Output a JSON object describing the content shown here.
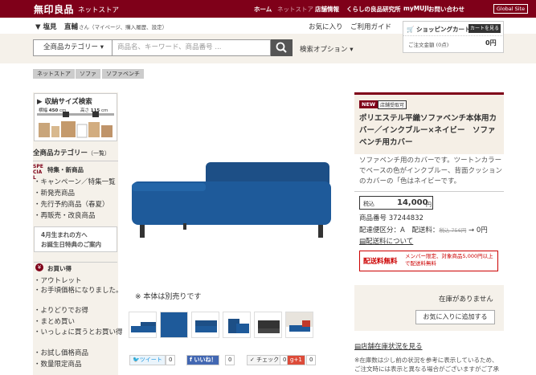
{
  "header": {
    "logo": "無印良品",
    "store": "ネットストア",
    "nav": [
      "ホーム",
      "ネットストア",
      "店舗情報",
      "くらしの良品研究所",
      "myMUJI",
      "お問い合わせ"
    ],
    "global": "Global Site"
  },
  "user": {
    "location": "▼ 塩見",
    "name": "直輔",
    "suffix": "さん（マイページ、購入履歴、設定）",
    "links": [
      "お気に入り",
      "ご利用ガイド"
    ]
  },
  "cart": {
    "title": "ショッピングカート",
    "view_label": "カートを見る",
    "total_label": "ご注文金額",
    "count": "(0点)",
    "amount": "0円"
  },
  "search": {
    "category": "全商品カテゴリー",
    "placeholder": "商品名、キーワード、商品番号 ...",
    "options_label": "検索オプション"
  },
  "breadcrumbs": [
    "ネットストア",
    "ソファ",
    "ソファベンチ"
  ],
  "sidebar": {
    "storage_title": "収納サイズ検索",
    "width_label": "横幅",
    "width_value": "450",
    "depth_label": "高さ",
    "depth_value": "115",
    "unit": "cm",
    "categories_title": "全商品カテゴリー",
    "categories_sub": "（一覧）",
    "special_badge": "SPECIAL",
    "special_title": "特集・新商品",
    "special_items": [
      "キャンペーン／特集一覧",
      "新発売商品",
      "先行予約商品（春夏）",
      "再販売・改良商品"
    ],
    "banner": [
      "4月生まれの方へ",
      "お誕生日特典のご案内"
    ],
    "bargain_title": "お買い得",
    "bargain_mark": "¥",
    "bargain_items": [
      "アウトレット",
      "お手頃価格になりました。",
      "よりどりでお得",
      "まとめ買い",
      "いっしょに買うとお買い得",
      "お試し価格商品",
      "数量限定商品"
    ]
  },
  "product": {
    "badges": [
      "NEW",
      "店舗受取可"
    ],
    "title": "ポリエステル平織ソファベンチ本体用カバー／インクブルー×ネイビー　ソファベンチ用カバー",
    "description": "ソファベンチ用のカバーです。ツートンカラーでベースの色がインクブルー、背面クッションのカバーの「色はネイビーです。",
    "price_label": "税込",
    "price": "14,000",
    "price_unit": "円",
    "item_no": "商品番号 37244832",
    "ship_area": "配達便区分：A",
    "ship_fee_label": "配送料：",
    "ship_fee_old": "税込 756円",
    "ship_fee_new": "→ 0円",
    "ship_link": "配送料について",
    "free_label": "配送料無料",
    "free_note": "メンバー限定、対象商品5,000円以上で配送料無料",
    "stock": "在庫がありません",
    "fav_button": "お気に入りに追加する",
    "stock_link": "店舗在庫状況を見る",
    "footnote": "※在庫数は少し前の状況を参考に表示しているため、ご注文時には表示と異なる場合がございますがご了承ください。",
    "note": "※ 本体は別売りです"
  },
  "share": {
    "tweet": "ツイート",
    "tweet_count": "0",
    "like": "いいね！",
    "like_count": "0",
    "check": "チェック",
    "check_count": "0",
    "gplus": "+1",
    "gplus_count": "0"
  },
  "colors": {
    "brand": "#7f0019",
    "beige": "#f5f1ea",
    "sofa": "#1e5a9a"
  }
}
